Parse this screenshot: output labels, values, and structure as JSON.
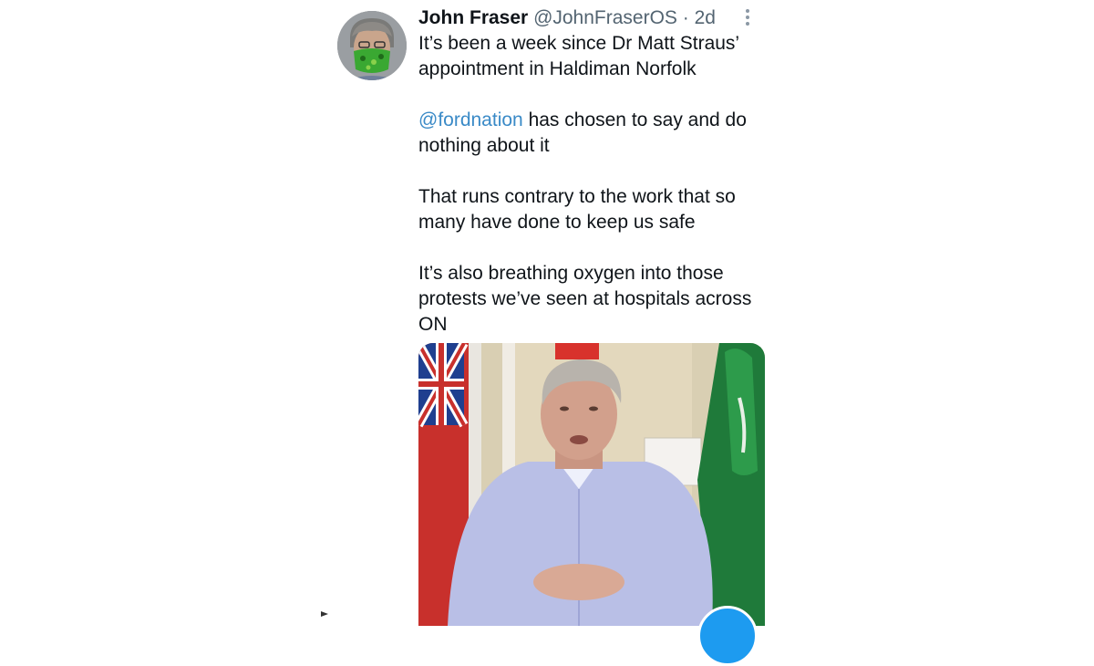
{
  "tweet": {
    "author_name": "John Fraser",
    "author_handle": "@JohnFraserOS",
    "separator": " · ",
    "time": "2d",
    "more_icon": "more-vertical-icon",
    "paragraphs": {
      "p1": "It’s been a week since Dr Matt Straus’ appointment in Haldiman Norfolk",
      "p2_mention": "@fordnation",
      "p2_rest": " has chosen to say and do nothing about it",
      "p3": "That runs contrary to the work that so many have done to keep us safe",
      "p4": "It’s also breathing oxygen into those protests we’ve seen at hospitals across ON"
    },
    "colors": {
      "mention": "#3a8ac7",
      "text": "#0f1419",
      "secondary": "#536471"
    }
  }
}
